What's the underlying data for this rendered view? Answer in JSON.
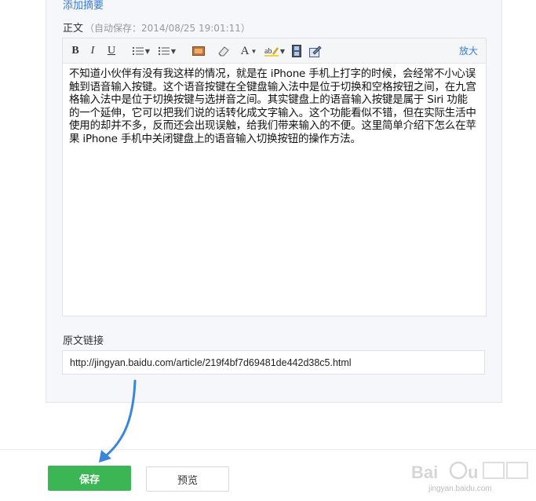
{
  "summary": {
    "add_label": "添加摘要"
  },
  "body_field": {
    "label": "正文",
    "autosave": "（自动保存：2014/08/25 19:01:11）"
  },
  "toolbar": {
    "bold": "B",
    "italic": "I",
    "underline": "U",
    "font_color": "A",
    "enlarge": "放大",
    "icons": [
      "bold-icon",
      "italic-icon",
      "underline-icon",
      "ordered-list-icon",
      "unordered-list-icon",
      "image-icon",
      "eraser-icon",
      "font-color-icon",
      "highlight-icon",
      "film-icon",
      "insert-icon"
    ]
  },
  "content": {
    "text": "不知道小伙伴有没有我这样的情况，就是在 iPhone 手机上打字的时候，会经常不小心误触到语音输入按键。这个语音按键在全键盘输入法中是位于切换和空格按钮之间，在九宫格输入法中是位于切换按键与选拼音之间。其实键盘上的语音输入按键是属于 Siri 功能的一个延伸，它可以把我们说的话转化成文字输入。这个功能看似不错，但在实际生活中使用的却并不多，反而还会出现误触，给我们带来输入的不便。这里简单介绍下怎么在苹果 iPhone 手机中关闭键盘上的语音输入切换按钮的操作方法。"
  },
  "source_link": {
    "label": "原文链接",
    "value": "http://jingyan.baidu.com/article/219f4bf7d69481de442d38c5.html"
  },
  "actions": {
    "save": "保存",
    "preview": "预览"
  },
  "watermark": {
    "url": "jingyan.baidu.com"
  },
  "colors": {
    "save_green": "#3cb554",
    "link_blue": "#3a7bd5",
    "arrow_blue": "#3a86d8"
  }
}
